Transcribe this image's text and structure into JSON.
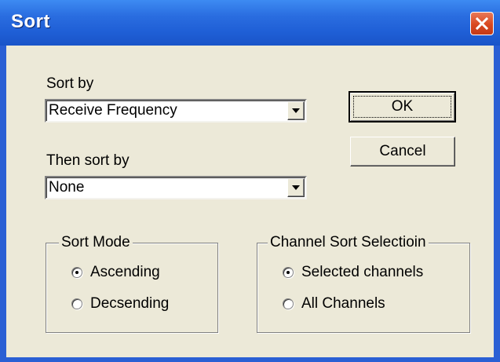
{
  "window": {
    "title": "Sort"
  },
  "sort_by": {
    "label": "Sort by",
    "selected": "Receive Frequency"
  },
  "then_sort_by": {
    "label": "Then sort by",
    "selected": "None"
  },
  "buttons": {
    "ok": "OK",
    "cancel": "Cancel"
  },
  "sort_mode": {
    "legend": "Sort Mode",
    "options": [
      {
        "label": "Ascending",
        "checked": true
      },
      {
        "label": "Decsending",
        "checked": false
      }
    ]
  },
  "channel_sort": {
    "legend": "Channel Sort Selectioin",
    "options": [
      {
        "label": "Selected channels",
        "checked": true
      },
      {
        "label": "All Channels",
        "checked": false
      }
    ]
  },
  "colors": {
    "titlebar": "#2a6de0",
    "client": "#ece9d8",
    "close": "#d9471f"
  },
  "icons": {
    "close": "close-icon",
    "dropdown": "chevron-down-icon"
  }
}
